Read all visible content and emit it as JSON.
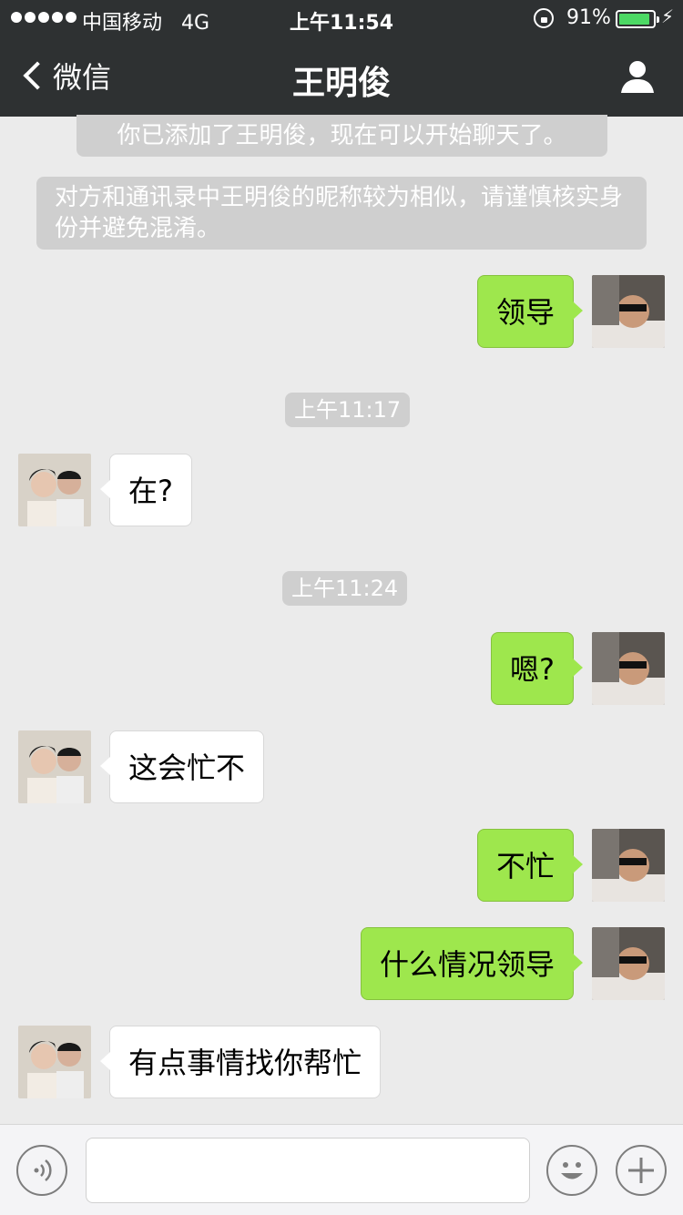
{
  "status_bar": {
    "carrier": "中国移动",
    "network": "4G",
    "time": "上午11:54",
    "battery_percent": "91%",
    "battery_level": 0.91,
    "battery_color": "#4cd964"
  },
  "nav": {
    "back_label": "微信",
    "title": "王明俊",
    "profile_icon": "person-icon"
  },
  "system_messages": [
    "你已添加了王明俊，现在可以开始聊天了。",
    "对方和通讯录中王明俊的昵称较为相似，请谨慎核实身份并避免混淆。"
  ],
  "timestamps": [
    "上午11:17",
    "上午11:24"
  ],
  "messages": [
    {
      "sender": "me",
      "text": "领导"
    },
    {
      "sender": "them",
      "text": "在?"
    },
    {
      "sender": "me",
      "text": "嗯?"
    },
    {
      "sender": "them",
      "text": "这会忙不"
    },
    {
      "sender": "me",
      "text": "不忙"
    },
    {
      "sender": "me",
      "text": "什么情况领导"
    },
    {
      "sender": "them",
      "text": "有点事情找你帮忙"
    }
  ],
  "colors": {
    "my_bubble": "#9ee74d",
    "their_bubble": "#ffffff",
    "nav_bg": "#2e3132"
  },
  "input_bar": {
    "voice_icon": "voice-icon",
    "emoji_icon": "emoji-icon",
    "plus_icon": "plus-icon",
    "text_value": ""
  }
}
